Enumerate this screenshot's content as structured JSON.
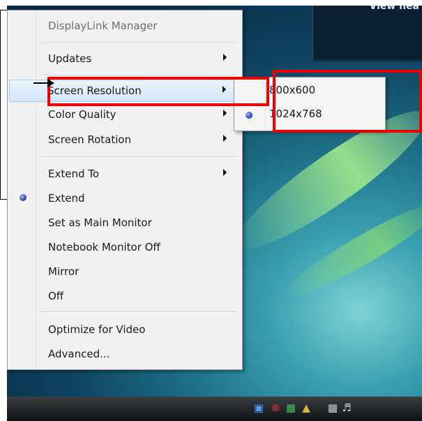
{
  "desktop": {
    "gadget_text": "View hea"
  },
  "menu": {
    "title": "DisplayLink Manager",
    "items": [
      {
        "label": "Updates",
        "submenu": true
      },
      {
        "label": "Screen Resolution",
        "submenu": true,
        "highlighted": true
      },
      {
        "label": "Color Quality",
        "submenu": true
      },
      {
        "label": "Screen Rotation",
        "submenu": true
      },
      {
        "label": "Extend To",
        "submenu": true
      },
      {
        "label": "Extend",
        "checked": true
      },
      {
        "label": "Set as Main Monitor"
      },
      {
        "label": "Notebook Monitor Off"
      },
      {
        "label": "Mirror"
      },
      {
        "label": "Off"
      },
      {
        "label": "Optimize for Video"
      },
      {
        "label": "Advanced..."
      }
    ]
  },
  "submenu": {
    "items": [
      {
        "label": "800x600",
        "checked": false
      },
      {
        "label": "1024x768",
        "checked": true
      }
    ]
  },
  "taskbar": {
    "tray_icons": [
      "network-icon",
      "security-alert-icon",
      "displaylink-icon",
      "lock-icon",
      "network-disconnected-icon",
      "speaker-icon"
    ]
  },
  "colors": {
    "annotation_red": "#ee0000",
    "menu_highlight": "#d3e6f9",
    "radio_blue": "#3951b3"
  }
}
